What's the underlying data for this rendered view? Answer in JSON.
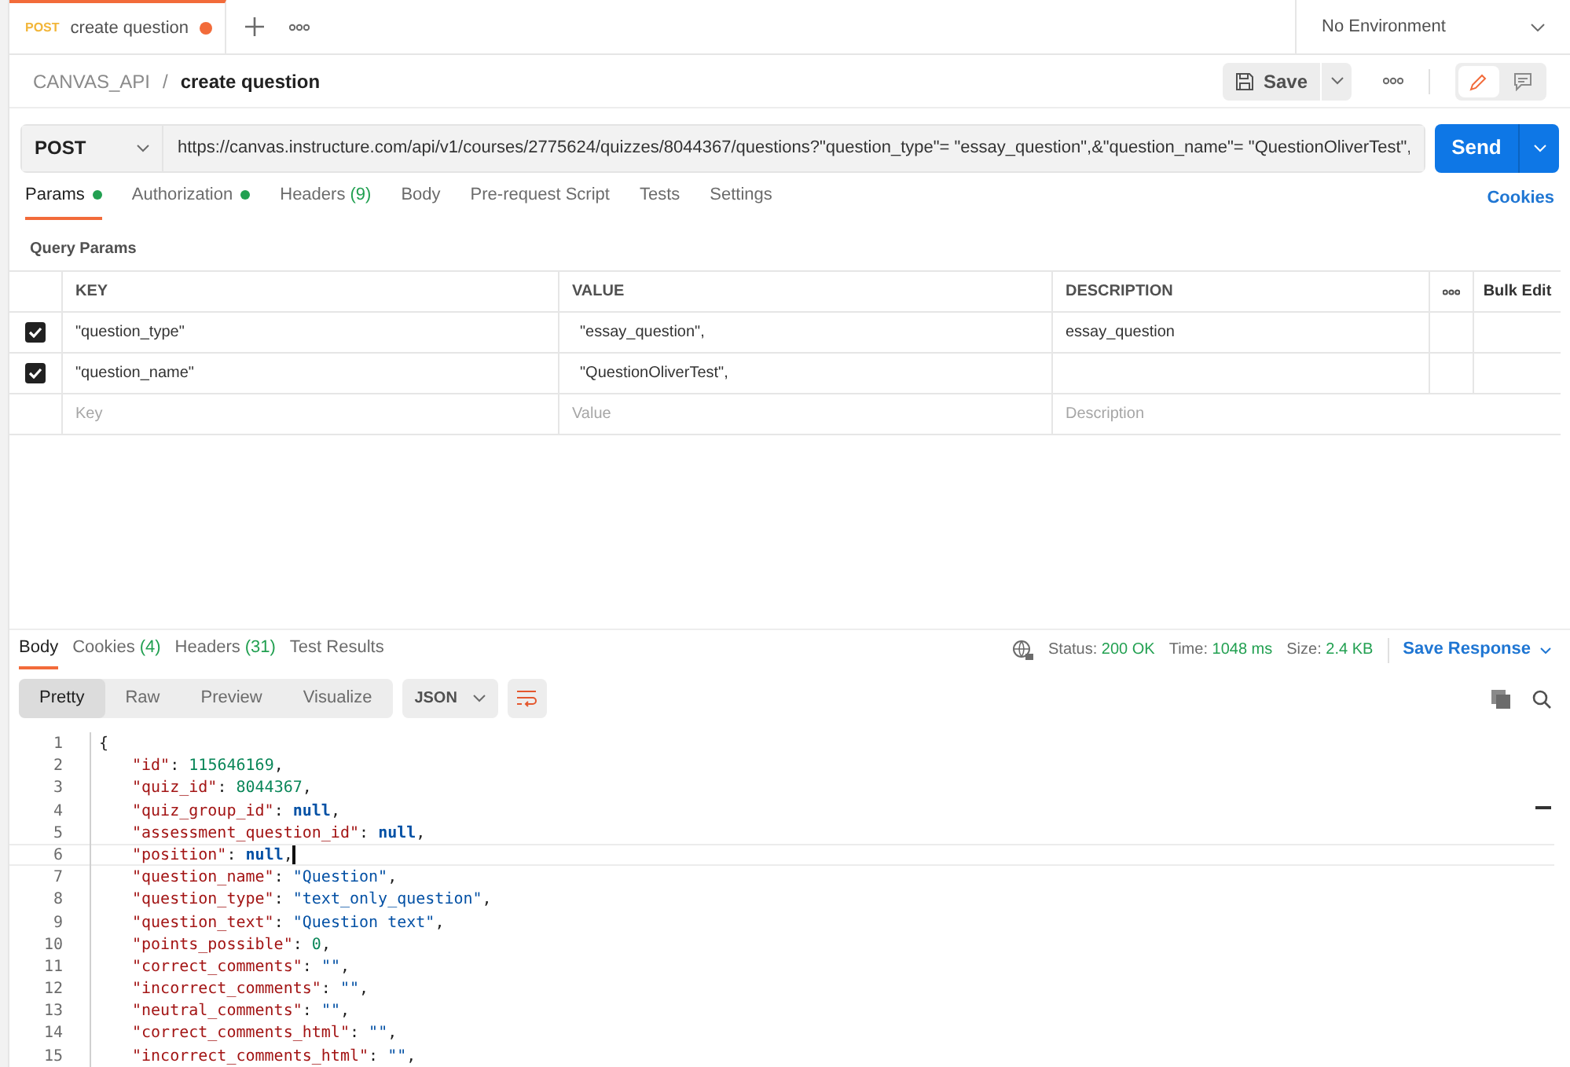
{
  "tabs": [
    {
      "method": "POST",
      "title": "create question",
      "unsaved": true,
      "selected": true
    }
  ],
  "environment": "No Environment",
  "breadcrumb": {
    "collection": "CANVAS_API",
    "separator": "/",
    "request": "create question"
  },
  "save_button": "Save",
  "request": {
    "method": "POST",
    "url": "https://canvas.instructure.com/api/v1/courses/2775624/quizzes/8044367/questions?\"question_type\"= \"essay_question\",&\"question_name\"= \"QuestionOliverTest\",",
    "send": "Send"
  },
  "request_tabs": [
    {
      "label": "Params",
      "dot": true,
      "selected": true
    },
    {
      "label": "Authorization",
      "dot": true,
      "selected": false
    },
    {
      "label": "Headers",
      "count": "(9)",
      "dot": false,
      "selected": false
    },
    {
      "label": "Body",
      "dot": false,
      "selected": false
    },
    {
      "label": "Pre-request Script",
      "dot": false,
      "selected": false
    },
    {
      "label": "Tests",
      "dot": false,
      "selected": false
    },
    {
      "label": "Settings",
      "dot": false,
      "selected": false
    }
  ],
  "cookies_link": "Cookies",
  "query_params": {
    "title": "Query Params",
    "columns": [
      "KEY",
      "VALUE",
      "DESCRIPTION"
    ],
    "bulk_edit": "Bulk Edit",
    "rows": [
      {
        "checked": true,
        "key": "\"question_type\"",
        "value": "\"essay_question\",",
        "description": "essay_question"
      },
      {
        "checked": true,
        "key": "\"question_name\"",
        "value": "\"QuestionOliverTest\",",
        "description": ""
      }
    ],
    "new_row": [
      {
        "placeholder": "Key"
      },
      {
        "placeholder": "Value"
      },
      {
        "placeholder": "Description"
      }
    ]
  },
  "response_tabs": [
    {
      "label": "Body",
      "selected": true
    },
    {
      "label": "Cookies",
      "count": "(4)",
      "selected": false
    },
    {
      "label": "Headers",
      "count": "(31)",
      "selected": false
    },
    {
      "label": "Test Results",
      "selected": false
    }
  ],
  "status": [
    {
      "label": "Status:",
      "value": "200 OK"
    },
    {
      "label": "Time:",
      "value": "1048 ms"
    },
    {
      "label": "Size:",
      "value": "2.4 KB"
    }
  ],
  "save_response": "Save Response",
  "view_modes": [
    {
      "label": "Pretty",
      "selected": true
    },
    {
      "label": "Raw",
      "selected": false
    },
    {
      "label": "Preview",
      "selected": false
    },
    {
      "label": "Visualize",
      "selected": false
    }
  ],
  "format": "JSON",
  "code_lines": [
    {
      "number": "1",
      "current": false,
      "text": "{"
    },
    {
      "number": "2",
      "current": false,
      "text": "\"id\": 115646169,"
    },
    {
      "number": "3",
      "current": false,
      "text": "\"quiz_id\": 8044367,"
    },
    {
      "number": "4",
      "current": false,
      "text": "\"quiz_group_id\": null,"
    },
    {
      "number": "5",
      "current": false,
      "text": "\"assessment_question_id\": null,"
    },
    {
      "number": "6",
      "current": true,
      "text": "\"position\": null,"
    },
    {
      "number": "7",
      "current": false,
      "text": "\"question_name\": \"Question\","
    },
    {
      "number": "8",
      "current": false,
      "text": "\"question_type\": \"text_only_question\","
    },
    {
      "number": "9",
      "current": false,
      "text": "\"question_text\": \"Question text\","
    },
    {
      "number": "10",
      "current": false,
      "text": "\"points_possible\": 0,"
    },
    {
      "number": "11",
      "current": false,
      "text": "\"correct_comments\": \"\","
    },
    {
      "number": "12",
      "current": false,
      "text": "\"incorrect_comments\": \"\","
    },
    {
      "number": "13",
      "current": false,
      "text": "\"neutral_comments\": \"\","
    },
    {
      "number": "14",
      "current": false,
      "text": "\"correct_comments_html\": \"\","
    },
    {
      "number": "15",
      "current": false,
      "text": "\"incorrect_comments_html\": \"\","
    }
  ]
}
